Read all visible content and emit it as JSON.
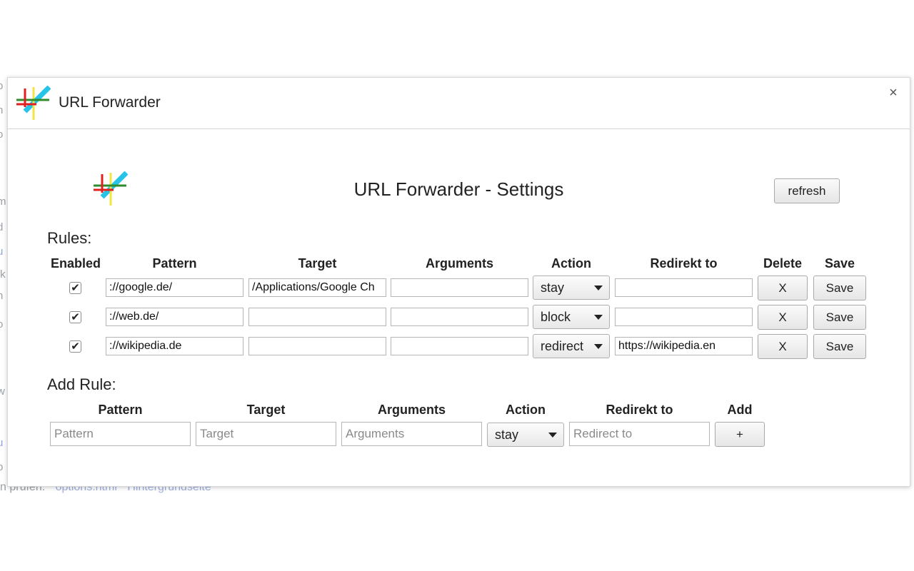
{
  "window": {
    "title": "URL Forwarder",
    "close_label": "×"
  },
  "settings": {
    "title": "URL Forwarder - Settings",
    "refresh_label": "refresh"
  },
  "background": {
    "fragments": [
      "p",
      "n",
      "o",
      "m",
      "d",
      "u",
      "fk",
      "n",
      "o",
      "w",
      "l",
      "u",
      "b"
    ],
    "bottom_text": "n prüfen:",
    "bottom_links": [
      "options.html",
      "Hintergrundseite"
    ]
  },
  "rules": {
    "label": "Rules:",
    "columns": [
      "Enabled",
      "Pattern",
      "Target",
      "Arguments",
      "Action",
      "Redirekt to",
      "Delete",
      "Save"
    ],
    "rows": [
      {
        "enabled_mark": "✔",
        "pattern": "://google.de/",
        "target": "/Applications/Google Ch",
        "arguments": "",
        "action": "stay",
        "redirect": "",
        "delete_label": "X",
        "save_label": "Save"
      },
      {
        "enabled_mark": "✔",
        "pattern": "://web.de/",
        "target": "",
        "arguments": "",
        "action": "block",
        "redirect": "",
        "delete_label": "X",
        "save_label": "Save"
      },
      {
        "enabled_mark": "✔",
        "pattern": "://wikipedia.de",
        "target": "",
        "arguments": "",
        "action": "redirect",
        "redirect": "https://wikipedia.en",
        "delete_label": "X",
        "save_label": "Save"
      }
    ]
  },
  "add_rule": {
    "label": "Add Rule:",
    "columns": [
      "Pattern",
      "Target",
      "Arguments",
      "Action",
      "Redirekt to",
      "Add"
    ],
    "placeholders": {
      "pattern": "Pattern",
      "target": "Target",
      "arguments": "Arguments",
      "redirect": "Redirect to"
    },
    "action": "stay",
    "add_label": "+"
  },
  "colors": {
    "logo_green": "#2e8b2e",
    "logo_red": "#e02020",
    "logo_yellow": "#f2e640",
    "logo_cyan": "#27c4e8"
  }
}
